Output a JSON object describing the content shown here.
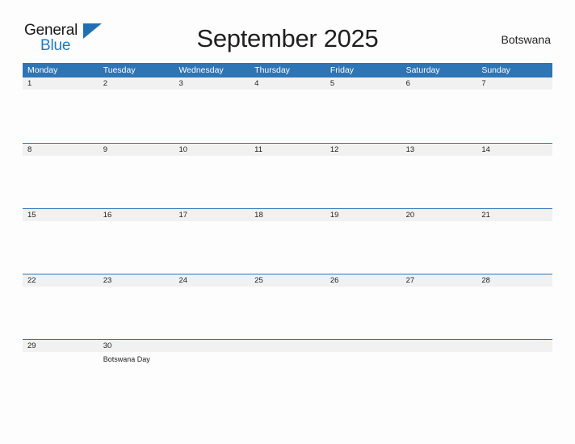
{
  "brand": {
    "name_part1": "General",
    "name_part2": "Blue",
    "flag_icon": "blue-triangle-flag",
    "accent_color": "#1f6fb5"
  },
  "header": {
    "title": "September 2025",
    "country": "Botswana"
  },
  "theme": {
    "header_blue": "#2e75b6",
    "band_gray": "#f1f1f1",
    "page_background": "#fdfdfd",
    "text_color": "#222222"
  },
  "calendar": {
    "month": "September",
    "year": "2025",
    "week_start": "Monday",
    "weekdays": [
      "Monday",
      "Tuesday",
      "Wednesday",
      "Thursday",
      "Friday",
      "Saturday",
      "Sunday"
    ],
    "weeks": [
      {
        "days": [
          {
            "date": "1",
            "events": []
          },
          {
            "date": "2",
            "events": []
          },
          {
            "date": "3",
            "events": []
          },
          {
            "date": "4",
            "events": []
          },
          {
            "date": "5",
            "events": []
          },
          {
            "date": "6",
            "events": []
          },
          {
            "date": "7",
            "events": []
          }
        ]
      },
      {
        "days": [
          {
            "date": "8",
            "events": []
          },
          {
            "date": "9",
            "events": []
          },
          {
            "date": "10",
            "events": []
          },
          {
            "date": "11",
            "events": []
          },
          {
            "date": "12",
            "events": []
          },
          {
            "date": "13",
            "events": []
          },
          {
            "date": "14",
            "events": []
          }
        ]
      },
      {
        "days": [
          {
            "date": "15",
            "events": []
          },
          {
            "date": "16",
            "events": []
          },
          {
            "date": "17",
            "events": []
          },
          {
            "date": "18",
            "events": []
          },
          {
            "date": "19",
            "events": []
          },
          {
            "date": "20",
            "events": []
          },
          {
            "date": "21",
            "events": []
          }
        ]
      },
      {
        "days": [
          {
            "date": "22",
            "events": []
          },
          {
            "date": "23",
            "events": []
          },
          {
            "date": "24",
            "events": []
          },
          {
            "date": "25",
            "events": []
          },
          {
            "date": "26",
            "events": []
          },
          {
            "date": "27",
            "events": []
          },
          {
            "date": "28",
            "events": []
          }
        ]
      },
      {
        "days": [
          {
            "date": "29",
            "events": []
          },
          {
            "date": "30",
            "events": [
              "Botswana Day"
            ]
          },
          {
            "date": "",
            "events": []
          },
          {
            "date": "",
            "events": []
          },
          {
            "date": "",
            "events": []
          },
          {
            "date": "",
            "events": []
          },
          {
            "date": "",
            "events": []
          }
        ]
      }
    ]
  }
}
